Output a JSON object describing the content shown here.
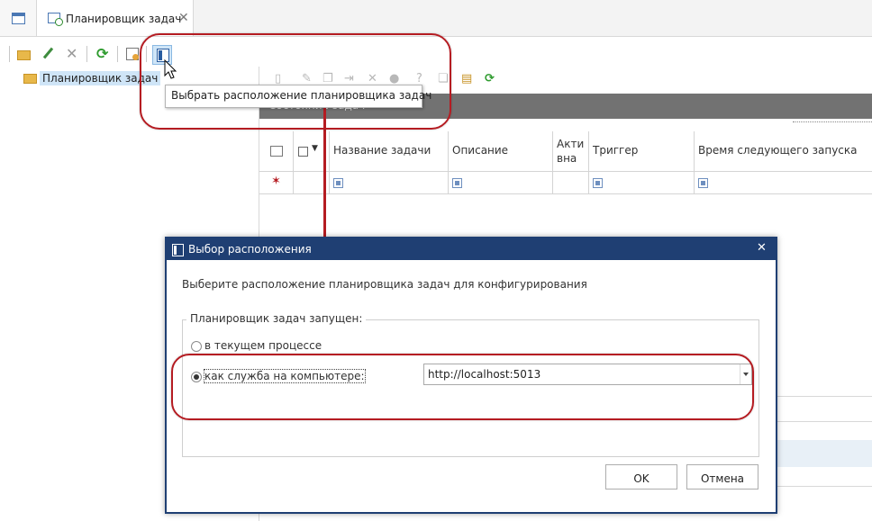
{
  "tabs": {
    "active_label": "Планировщик задач",
    "close_glyph": "✕"
  },
  "tree": {
    "root_label": "Планировщик задач"
  },
  "tooltip": {
    "text": "Выбрать расположение планировщика задач"
  },
  "status_panel": {
    "label": "Состояние задач"
  },
  "grid": {
    "columns": [
      "Название задачи",
      "Описание",
      "Акти вна",
      "Триггер",
      "Время следующего запуска"
    ]
  },
  "dialog": {
    "title": "Выбор расположения",
    "close_glyph": "✕",
    "prompt": "Выберите расположение планировщика задач для конфигурирования",
    "group_legend": "Планировщик задач запущен:",
    "option_in_process": "в текущем процессе",
    "option_service": "как служба на компьютере:",
    "selected_option": "service",
    "service_url": "http://localhost:5013",
    "ok_label": "OK",
    "cancel_label": "Отмена"
  },
  "icons": {
    "toolbar": [
      "add-folder-icon",
      "edit-icon",
      "delete-icon",
      "refresh-icon",
      "scheduler-settings-icon",
      "select-location-icon"
    ]
  },
  "colors": {
    "annotation_red": "#b51c22",
    "dialog_title": "#1f3f73",
    "selection": "#cfe5f7"
  }
}
